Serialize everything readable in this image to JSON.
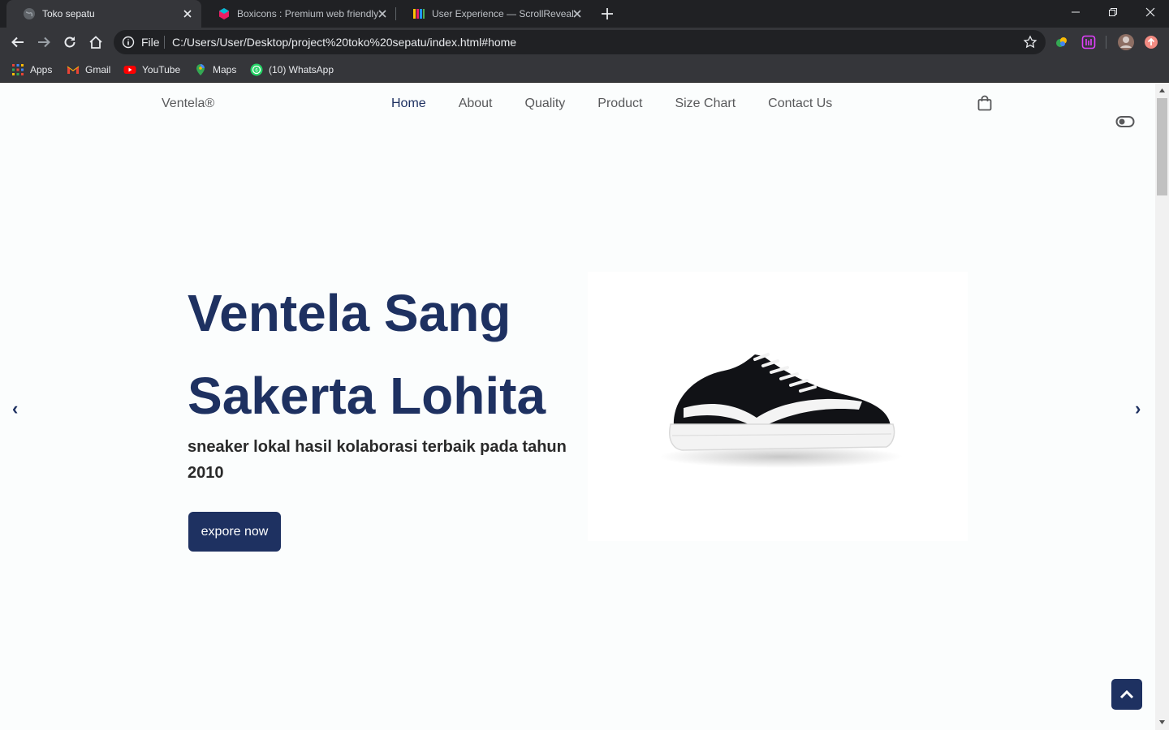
{
  "browser": {
    "tabs": [
      {
        "title": "Toko sepatu",
        "favicon": "globe-icon",
        "active": true
      },
      {
        "title": "Boxicons : Premium web friendly",
        "favicon": "boxicons-icon",
        "active": false
      },
      {
        "title": "User Experience — ScrollReveal",
        "favicon": "scrollreveal-icon",
        "active": false
      }
    ],
    "omnibox": {
      "scheme_label": "File",
      "url": "C:/Users/User/Desktop/project%20toko%20sepatu/index.html#home"
    },
    "bookmarks": [
      {
        "label": "Apps",
        "icon": "apps-grid-icon"
      },
      {
        "label": "Gmail",
        "icon": "gmail-icon"
      },
      {
        "label": "YouTube",
        "icon": "youtube-icon"
      },
      {
        "label": "Maps",
        "icon": "maps-icon"
      },
      {
        "label": "(10) WhatsApp",
        "icon": "whatsapp-icon"
      }
    ]
  },
  "site": {
    "brand": "Ventela®",
    "nav": [
      "Home",
      "About",
      "Quality",
      "Product",
      "Size Chart",
      "Contact Us"
    ],
    "active_nav": "Home",
    "hero": {
      "title_line1": "Ventela Sang",
      "title_line2": "Sakerta Lohita",
      "subtitle": "sneaker lokal hasil kolaborasi terbaik pada tahun 2010",
      "cta": "expore now"
    },
    "carousel": {
      "prev": "‹",
      "next": "›"
    }
  },
  "colors": {
    "primary": "#1e3161",
    "nav_text": "#58595b",
    "page_bg": "#fbfdfd",
    "chrome_dark": "#202124",
    "chrome_toolbar": "#35363a"
  }
}
